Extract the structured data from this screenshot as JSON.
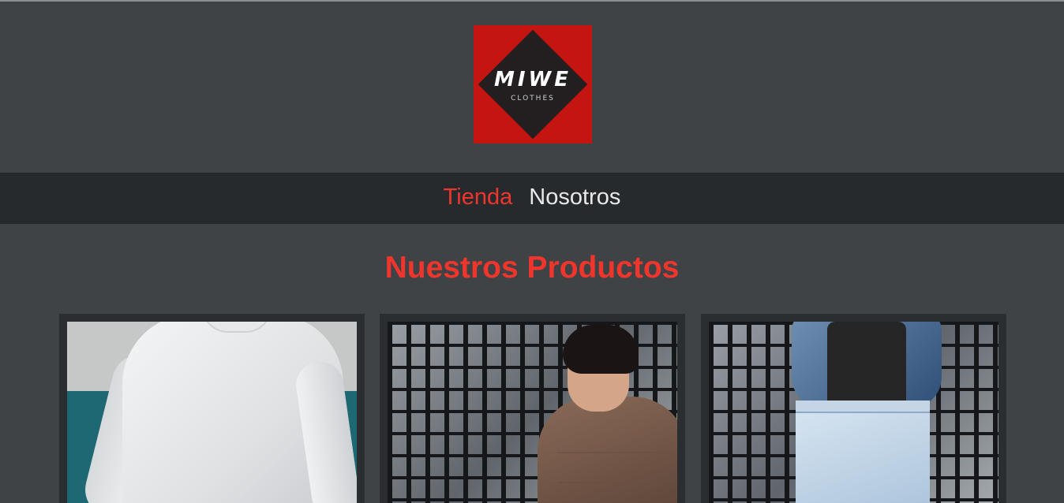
{
  "logo": {
    "brand": "MIWE",
    "tagline": "CLOTHES",
    "colors": {
      "background": "#c41511",
      "diamond": "#231f20"
    }
  },
  "nav": {
    "items": [
      {
        "label": "Tienda",
        "active": true
      },
      {
        "label": "Nosotros",
        "active": false
      }
    ]
  },
  "section": {
    "title": "Nuestros Productos"
  },
  "products": [
    {
      "image": "white-sweatshirt-photo"
    },
    {
      "image": "brown-sweatshirt-photo"
    },
    {
      "image": "denim-jacket-photo"
    }
  ],
  "colors": {
    "page_background": "#3f4346",
    "nav_background": "#272a2c",
    "accent": "#f0362c",
    "card_background": "#2b2e30"
  }
}
